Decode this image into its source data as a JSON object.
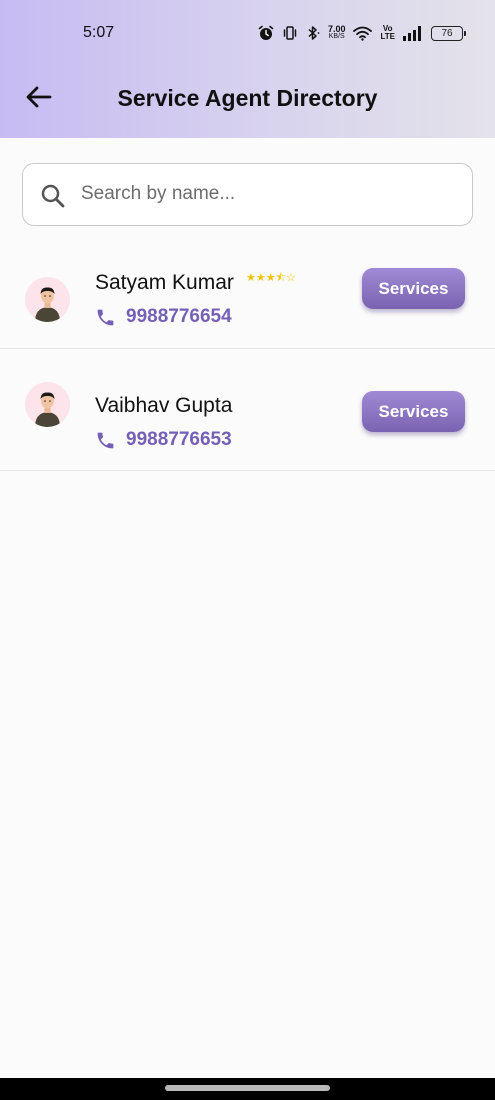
{
  "status_bar": {
    "time": "5:07",
    "net_speed_value": "7.00",
    "net_speed_unit": "KB/S",
    "volte_top": "Vo",
    "volte_bottom": "LTE",
    "battery_level": "76"
  },
  "header": {
    "title": "Service Agent Directory",
    "back_icon": "arrow-left-icon"
  },
  "search": {
    "placeholder": "Search by name...",
    "value": ""
  },
  "agents": [
    {
      "name": "Satyam Kumar",
      "rating_text": "★★★⯪☆",
      "rating_value": 3.5,
      "phone": "9988776654",
      "action_label": "Services"
    },
    {
      "name": "Vaibhav Gupta",
      "phone": "9988776653",
      "action_label": "Services"
    }
  ],
  "colors": {
    "accent": "#7560b6",
    "button_top": "#a08ad6",
    "button_bottom": "#7a63b0",
    "star": "#f2c200",
    "avatar_bg": "#fde4ea"
  }
}
